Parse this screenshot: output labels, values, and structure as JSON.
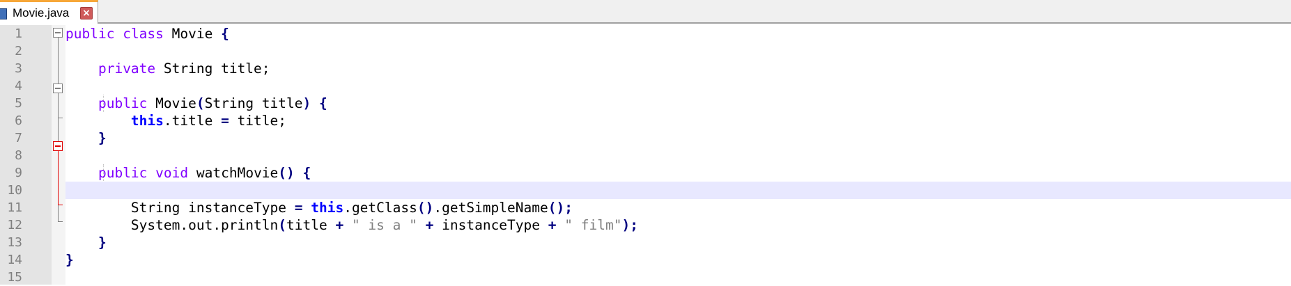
{
  "tab": {
    "label": "Movie.java",
    "close_glyph": "×",
    "icon": "java-file-icon"
  },
  "lines": [
    {
      "n": "1"
    },
    {
      "n": "2"
    },
    {
      "n": "3"
    },
    {
      "n": "4"
    },
    {
      "n": "5"
    },
    {
      "n": "6"
    },
    {
      "n": "7"
    },
    {
      "n": "8"
    },
    {
      "n": "9"
    },
    {
      "n": "10"
    },
    {
      "n": "11"
    },
    {
      "n": "12"
    },
    {
      "n": "13"
    },
    {
      "n": "14"
    },
    {
      "n": "15"
    }
  ],
  "code": {
    "l1": {
      "kw1": "public",
      "kw2": "class",
      "name": "Movie",
      "brace": "{"
    },
    "l3": {
      "kw": "private",
      "rest": "String title;"
    },
    "l5": {
      "kw": "public",
      "name": "Movie",
      "p1": "(",
      "args": "String title",
      "p2": ")",
      "brace": "{"
    },
    "l6": {
      "kw": "this",
      "a": ".title ",
      "eq": "=",
      "b": " title;"
    },
    "l7": {
      "brace": "}"
    },
    "l9": {
      "kw1": "public",
      "kw2": "void",
      "name": "watchMovie",
      "parens": "()",
      "brace": "{"
    },
    "l11": {
      "a": "String instanceType ",
      "eq": "=",
      "kw": "this",
      "b": ".getClass",
      "p1": "()",
      "c": ".getSimpleName",
      "p2": "()",
      "d": ";"
    },
    "l12": {
      "a": "System.out.println",
      "p1": "(",
      "b": "title ",
      "plus1": "+",
      "s1": "\" is a \"",
      "plus2": "+",
      "c": "instanceType ",
      "plus3": "+",
      "s2": "\" film\"",
      "p2": ")",
      "d": ";"
    },
    "l13": {
      "brace": "}"
    },
    "l14": {
      "brace": "}"
    }
  },
  "colors": {
    "keyword": "#8000ff",
    "keyword_bold": "#0000ff",
    "operator": "#000080",
    "string": "#808080",
    "current_line": "#e8e8ff",
    "fold_active": "#e00000"
  }
}
